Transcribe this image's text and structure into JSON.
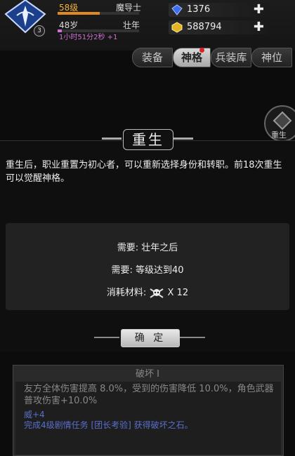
{
  "player": {
    "level": "58级",
    "class": "魔导士",
    "level_progress": 0.52,
    "age": "48岁",
    "age_stage": "壮年",
    "age_progress": 0.05,
    "timer": "1小时51分2秒 +1",
    "avatar_badge": "3"
  },
  "resources": [
    {
      "name": "gem",
      "icon": "blue-gem-icon",
      "value": "1376"
    },
    {
      "name": "gold",
      "icon": "gold-coin-icon",
      "value": "588794"
    }
  ],
  "tabs": [
    {
      "label": "装备",
      "active": false
    },
    {
      "label": "神格",
      "active": true
    },
    {
      "label": "兵装库",
      "active": false
    },
    {
      "label": "神位",
      "active": false
    }
  ],
  "side_button": {
    "label": "重生"
  },
  "modal": {
    "title": "重生",
    "description": "重生后，职业重置为初心者，可以重新选择身份和转职。前18次重生可以觉醒神格。",
    "requirements": [
      "需要: 壮年之后",
      "需要: 等级达到40"
    ],
    "material_label": "消耗材料:",
    "material_count": "X 12",
    "confirm": "确 定"
  },
  "panel": {
    "title": "破坏 I",
    "description": "友方全体伤害提高 8.0%，受到的伤害降低 10.0%，角色武器普攻伤害+10.0%",
    "stat": "威+4",
    "task": "完成4级剧情任务 [团长考验] 获得破坏之石。"
  },
  "colors": {
    "accent_orange": "#f0b33a",
    "accent_purple": "#d070d0",
    "link_blue": "#5a6fcc"
  }
}
